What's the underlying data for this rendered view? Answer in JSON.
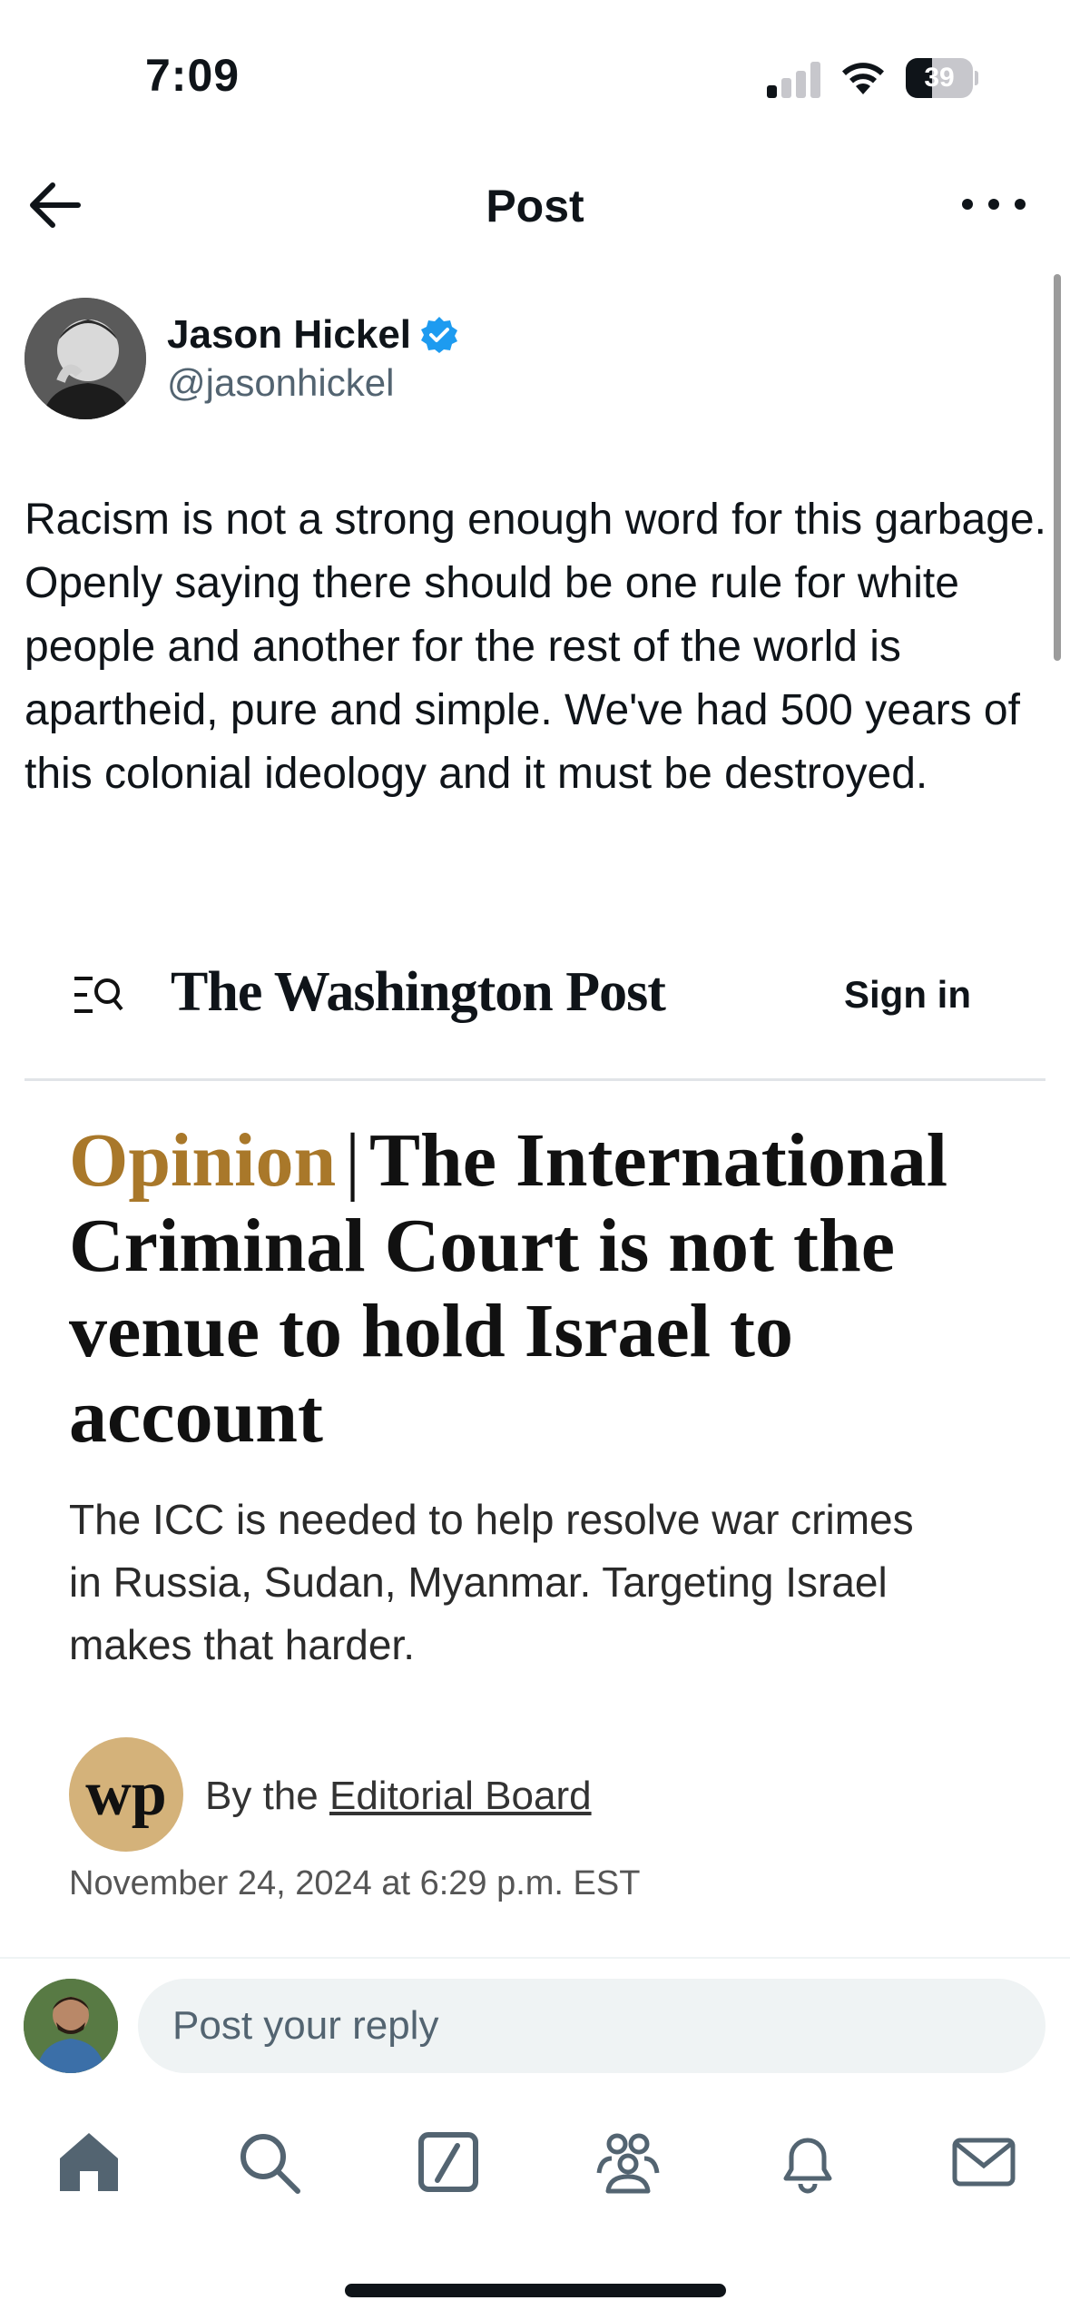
{
  "status_bar": {
    "time": "7:09",
    "battery_percent": "39",
    "battery_level": 0.39,
    "signal_bars": 1
  },
  "nav": {
    "title": "Post"
  },
  "author": {
    "name": "Jason Hickel",
    "handle": "@jasonhickel",
    "verified": true
  },
  "tweet": {
    "text": "Racism is not a strong enough word for this garbage. Openly saying there should be one rule for white people and another for the rest of the world is apartheid, pure and simple. We've had 500 years of this colonial ideology and it must be destroyed."
  },
  "article": {
    "masthead": "The Washington Post",
    "sign_in": "Sign in",
    "section": "Opinion",
    "separator": "|",
    "headline": "The International Criminal Court is not the venue to hold Israel to account",
    "subhead": "The ICC is needed to help resolve war crimes in Russia, Sudan, Myanmar. Targeting Israel makes that harder.",
    "badge": "wp",
    "byline_prefix": "By the",
    "byline_author": "Editorial Board",
    "date": "November 24, 2024 at 6:29 p.m. EST"
  },
  "reply": {
    "placeholder": "Post your reply"
  },
  "tabs": [
    "home-icon",
    "search-icon",
    "grok-icon",
    "communities-icon",
    "notifications-icon",
    "messages-icon"
  ],
  "colors": {
    "verified": "#1d9bf0",
    "opinion": "#a9782a",
    "wp_badge": "#d4b27a",
    "text_secondary": "#536471"
  }
}
